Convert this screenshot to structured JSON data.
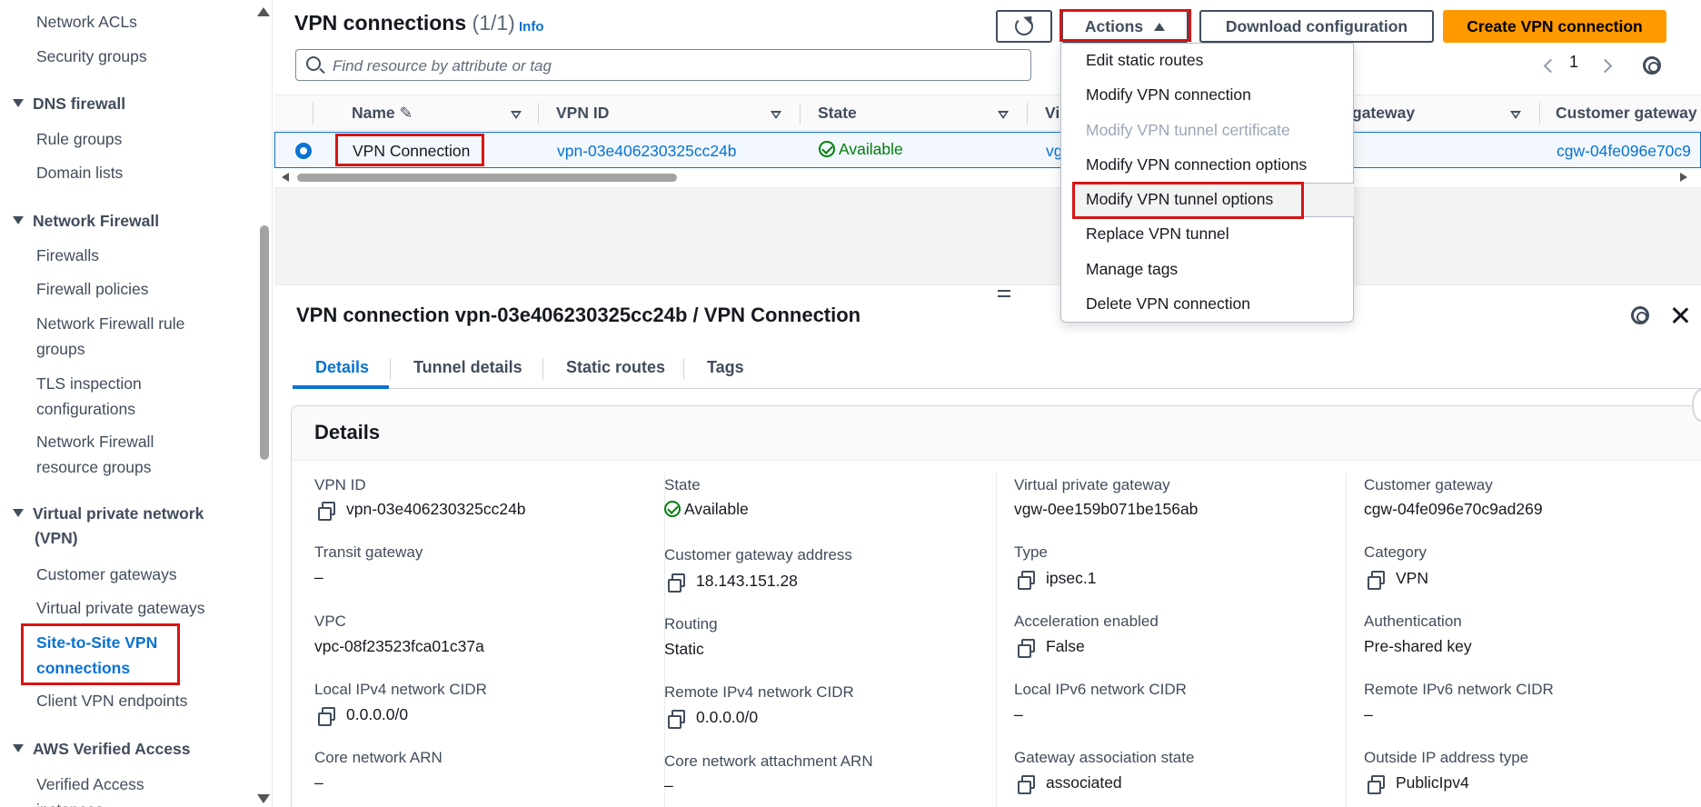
{
  "sidebar": {
    "items": [
      {
        "label": "Network ACLs",
        "type": "link"
      },
      {
        "label": "Security groups",
        "type": "link"
      },
      {
        "label": "DNS firewall",
        "type": "section"
      },
      {
        "label": "Rule groups",
        "type": "link"
      },
      {
        "label": "Domain lists",
        "type": "link"
      },
      {
        "label": "Network Firewall",
        "type": "section"
      },
      {
        "label": "Firewalls",
        "type": "link"
      },
      {
        "label": "Firewall policies",
        "type": "link"
      },
      {
        "label": "Network Firewall rule",
        "label2": "groups",
        "type": "link"
      },
      {
        "label": "TLS inspection",
        "label2": "configurations",
        "type": "link"
      },
      {
        "label": "Network Firewall",
        "label2": "resource groups",
        "type": "link"
      },
      {
        "label": "Virtual private network",
        "label2": "(VPN)",
        "type": "section"
      },
      {
        "label": "Customer gateways",
        "type": "link"
      },
      {
        "label": "Virtual private gateways",
        "type": "link"
      },
      {
        "label": "Site-to-Site VPN",
        "label2": "connections",
        "type": "active"
      },
      {
        "label": "Client VPN endpoints",
        "type": "link"
      },
      {
        "label": "AWS Verified Access",
        "type": "section"
      },
      {
        "label": "Verified Access",
        "label2": "instances",
        "type": "link"
      }
    ]
  },
  "header": {
    "title": "VPN connections",
    "count": "(1/1)",
    "info": "Info",
    "search_placeholder": "Find resource by attribute or tag",
    "actions_label": "Actions",
    "download_label": "Download configuration",
    "create_label": "Create VPN connection",
    "page_number": "1"
  },
  "table": {
    "columns": [
      "Name",
      "VPN ID",
      "State",
      "Vi",
      "gateway",
      "Customer gateway"
    ],
    "row": {
      "name": "VPN Connection",
      "vpn_id": "vpn-03e406230325cc24b",
      "state": "Available",
      "vgw": "vg",
      "cgw": "cgw-04fe096e70c9"
    }
  },
  "actions_menu": {
    "items": [
      {
        "label": "Edit static routes",
        "disabled": false
      },
      {
        "label": "Modify VPN connection",
        "disabled": false
      },
      {
        "label": "Modify VPN tunnel certificate",
        "disabled": true
      },
      {
        "label": "Modify VPN connection options",
        "disabled": false
      },
      {
        "label": "Modify VPN tunnel options",
        "disabled": false
      },
      {
        "label": "Replace VPN tunnel",
        "disabled": false
      },
      {
        "label": "Manage tags",
        "disabled": false
      },
      {
        "label": "Delete VPN connection",
        "disabled": false
      }
    ]
  },
  "details_panel": {
    "title": "VPN connection vpn-03e406230325cc24b / VPN Connection",
    "tabs": [
      "Details",
      "Tunnel details",
      "Static routes",
      "Tags"
    ],
    "card_title": "Details",
    "col1": [
      {
        "label": "VPN ID",
        "value": "vpn-03e406230325cc24b"
      },
      {
        "label": "Transit gateway",
        "value": "–"
      },
      {
        "label": "VPC",
        "value": "vpc-08f23523fca01c37a"
      },
      {
        "label": "Local IPv4 network CIDR",
        "value": "0.0.0.0/0"
      },
      {
        "label": "Core network ARN",
        "value": "–"
      }
    ],
    "col2": [
      {
        "label": "State",
        "value": "Available"
      },
      {
        "label": "Customer gateway address",
        "value": "18.143.151.28"
      },
      {
        "label": "Routing",
        "value": "Static"
      },
      {
        "label": "Remote IPv4 network CIDR",
        "value": "0.0.0.0/0"
      },
      {
        "label": "Core network attachment ARN",
        "value": "–"
      }
    ],
    "col3": [
      {
        "label": "Virtual private gateway",
        "value": "vgw-0ee159b071be156ab"
      },
      {
        "label": "Type",
        "value": "ipsec.1"
      },
      {
        "label": "Acceleration enabled",
        "value": "False"
      },
      {
        "label": "Local IPv6 network CIDR",
        "value": "–"
      },
      {
        "label": "Gateway association state",
        "value": "associated"
      }
    ],
    "col4": [
      {
        "label": "Customer gateway",
        "value": "cgw-04fe096e70c9ad269"
      },
      {
        "label": "Category",
        "value": "VPN"
      },
      {
        "label": "Authentication",
        "value": "Pre-shared key"
      },
      {
        "label": "Remote IPv6 network CIDR",
        "value": "–"
      },
      {
        "label": "Outside IP address type",
        "value": "PublicIpv4"
      }
    ]
  },
  "colors": {
    "link": "#0972d3",
    "success": "#037f0c",
    "primary_button": "#ff9900",
    "highlight_box": "#d91515"
  }
}
